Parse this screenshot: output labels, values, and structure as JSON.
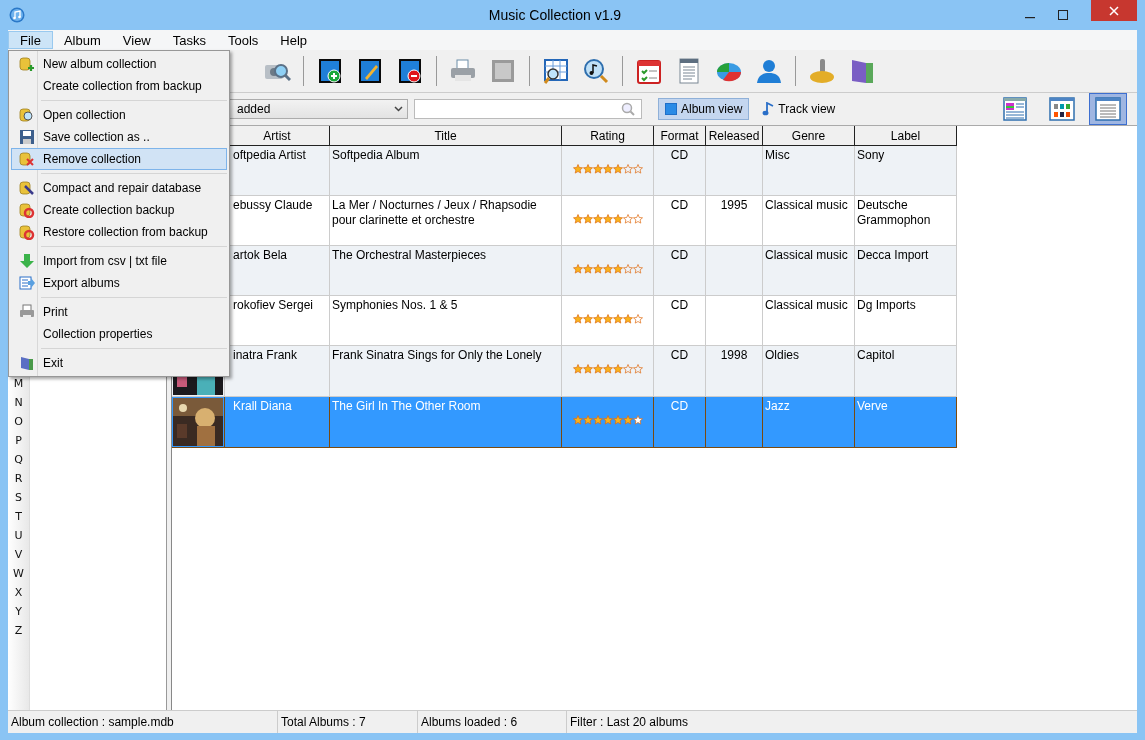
{
  "window": {
    "title": "Music Collection v1.9"
  },
  "menu_bar": [
    {
      "label": "File",
      "selected": true
    },
    {
      "label": "Album",
      "selected": false
    },
    {
      "label": "View",
      "selected": false
    },
    {
      "label": "Tasks",
      "selected": false
    },
    {
      "label": "Tools",
      "selected": false
    },
    {
      "label": "Help",
      "selected": false
    }
  ],
  "file_menu": [
    {
      "kind": "item",
      "label": "New album collection",
      "icon": true,
      "selected": false
    },
    {
      "kind": "item",
      "label": "Create collection from backup",
      "icon": false,
      "selected": false
    },
    {
      "kind": "separator"
    },
    {
      "kind": "item",
      "label": "Open collection",
      "icon": true,
      "selected": false
    },
    {
      "kind": "item",
      "label": "Save collection as ..",
      "icon": true,
      "selected": false
    },
    {
      "kind": "item",
      "label": "Remove collection",
      "icon": true,
      "selected": true
    },
    {
      "kind": "separator"
    },
    {
      "kind": "item",
      "label": "Compact and repair database",
      "icon": true,
      "selected": false
    },
    {
      "kind": "item",
      "label": "Create collection backup",
      "icon": true,
      "selected": false
    },
    {
      "kind": "item",
      "label": "Restore collection from backup",
      "icon": true,
      "selected": false
    },
    {
      "kind": "separator"
    },
    {
      "kind": "item",
      "label": "Import from csv | txt file",
      "icon": true,
      "selected": false
    },
    {
      "kind": "item",
      "label": "Export albums",
      "icon": true,
      "selected": false
    },
    {
      "kind": "separator"
    },
    {
      "kind": "item",
      "label": "Print",
      "icon": true,
      "selected": false
    },
    {
      "kind": "item",
      "label": "Collection properties",
      "icon": false,
      "selected": false
    },
    {
      "kind": "separator"
    },
    {
      "kind": "item",
      "label": "Exit",
      "icon": true,
      "selected": false
    }
  ],
  "filter": {
    "value": "added"
  },
  "view_toggle": [
    {
      "label": "Album view",
      "selected": true
    },
    {
      "label": "Track view",
      "selected": false
    }
  ],
  "layout_buttons": [
    {
      "selected": false
    },
    {
      "selected": false
    },
    {
      "selected": true
    }
  ],
  "letters": [
    "M",
    "N",
    "O",
    "P",
    "Q",
    "R",
    "S",
    "T",
    "U",
    "V",
    "W",
    "X",
    "Y",
    "Z"
  ],
  "table": {
    "columns": [
      "Artist",
      "Title",
      "Rating",
      "Format",
      "Released",
      "Genre",
      "Label"
    ],
    "rows": [
      {
        "cover": false,
        "artist": "oftpedia Artist",
        "title": "Softpedia Album",
        "stars": 5,
        "format": "CD",
        "released": "",
        "genre": "Misc",
        "label": "Sony",
        "selected": false
      },
      {
        "cover": false,
        "artist": "ebussy Claude",
        "title": "La Mer / Nocturnes / Jeux / Rhapsodie pour clarinette et orchestre",
        "stars": 5,
        "format": "CD",
        "released": "1995",
        "genre": "Classical music",
        "label": "Deutsche Grammophon",
        "selected": false
      },
      {
        "cover": false,
        "artist": "artok Bela",
        "title": "The Orchestral Masterpieces",
        "stars": 5,
        "format": "CD",
        "released": "",
        "genre": "Classical music",
        "label": "Decca Import",
        "selected": false
      },
      {
        "cover": false,
        "artist": "rokofiev Sergei",
        "title": "Symphonies Nos.  1 & 5",
        "stars": 6,
        "format": "CD",
        "released": "",
        "genre": "Classical music",
        "label": "Dg Imports",
        "selected": false
      },
      {
        "cover": true,
        "artist": "inatra Frank",
        "title": "Frank Sinatra Sings for Only the Lonely",
        "stars": 5,
        "format": "CD",
        "released": "1998",
        "genre": "Oldies",
        "label": "Capitol",
        "selected": false
      },
      {
        "cover": true,
        "artist": "Krall Diana",
        "title": "The Girl In The Other Room",
        "stars": 6,
        "format": "CD",
        "released": "",
        "genre": "Jazz",
        "label": "Verve",
        "selected": true
      }
    ]
  },
  "status_bar": [
    "Album collection : sample.mdb",
    "Total Albums : 7",
    "Albums loaded : 6",
    "Filter : Last 20 albums"
  ]
}
